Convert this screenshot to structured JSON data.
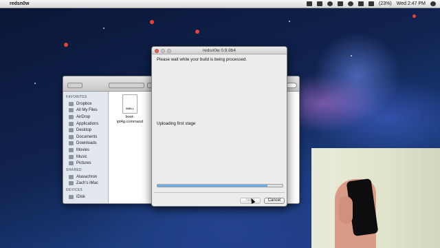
{
  "menubar": {
    "apple_glyph": "",
    "app_name": "redsn0w",
    "battery": "(23%)",
    "clock": "Wed 2:47 PM"
  },
  "finder": {
    "sidebar": {
      "favorites_header": "FAVORITES",
      "favorites": [
        "Dropbox",
        "All My Files",
        "AirDrop",
        "Applications",
        "Desktop",
        "Documents",
        "Downloads",
        "Movies",
        "Music",
        "Pictures"
      ],
      "shared_header": "SHARED",
      "shared": [
        "Atavachron",
        "Zach's iMac"
      ],
      "devices_header": "DEVICES",
      "devices": [
        "iDisk"
      ]
    },
    "file": {
      "badge": "SHELL",
      "name": "boot-ipt4g.command"
    }
  },
  "redsn0w": {
    "title": "redsn0w 0.9.9b4",
    "message": "Please wait while your build is being processed.",
    "status": "Uploading first stage",
    "progress": 0.88,
    "next_label": "Next",
    "cancel_label": "Cancel"
  },
  "colors": {
    "progress_blue": "#4b97dc",
    "close_red": "#ed5f55"
  }
}
